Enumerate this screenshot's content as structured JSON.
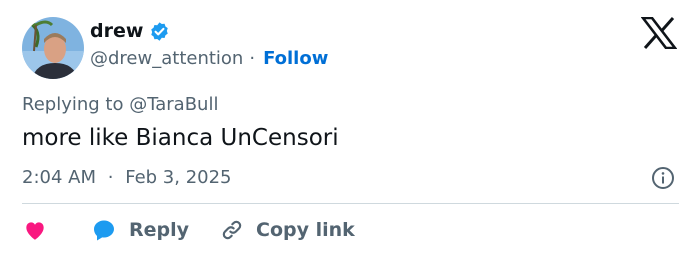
{
  "author": {
    "display_name": "drew",
    "handle": "@drew_attention",
    "separator": "·",
    "follow_label": "Follow",
    "verified_icon": "verified-badge-icon",
    "verified_color": "#1d9bf0"
  },
  "reply_context": {
    "prefix": "Replying to",
    "mention": "@TaraBull"
  },
  "tweet": {
    "text": "more like Bianca UnCensori",
    "time": "2:04 AM",
    "separator": "·",
    "date": "Feb 3, 2025"
  },
  "actions": {
    "like_icon": "heart-icon",
    "reply_label": "Reply",
    "copy_link_label": "Copy link"
  },
  "colors": {
    "text": "#0f1419",
    "secondary": "#536471",
    "link": "#006fd6",
    "like": "#f91880",
    "reply_bubble": "#1d9bf0",
    "divider": "#cfd9de"
  }
}
